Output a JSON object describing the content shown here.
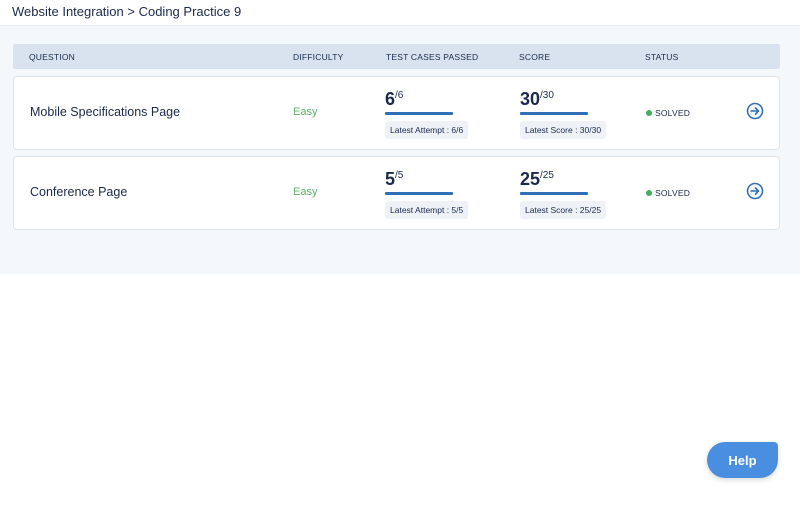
{
  "breadcrumb": "Website Integration > Coding Practice 9",
  "table": {
    "headers": [
      "QUESTION",
      "DIFFICULTY",
      "TEST CASES PASSED",
      "SCORE",
      "STATUS"
    ],
    "rows": [
      {
        "question": "Mobile Specifications Page",
        "difficulty": "Easy",
        "passed": "6",
        "total_cases": "/6",
        "attempt_label": "Latest Attempt : 6/6",
        "score": "30",
        "max_score": "/30",
        "score_label": "Latest Score : 30/30",
        "status": "SOLVED"
      },
      {
        "question": "Conference Page",
        "difficulty": "Easy",
        "passed": "5",
        "total_cases": "/5",
        "attempt_label": "Latest Attempt : 5/5",
        "score": "25",
        "max_score": "/25",
        "score_label": "Latest Score : 25/25",
        "status": "SOLVED"
      }
    ]
  },
  "help_label": "Help",
  "colors": {
    "accent": "#2f6fb8",
    "easy": "#5bb36a",
    "solved_dot": "#3fae5a",
    "help_button": "#4a8fdf"
  },
  "icons": {
    "go": "arrow-right-circle-icon"
  }
}
